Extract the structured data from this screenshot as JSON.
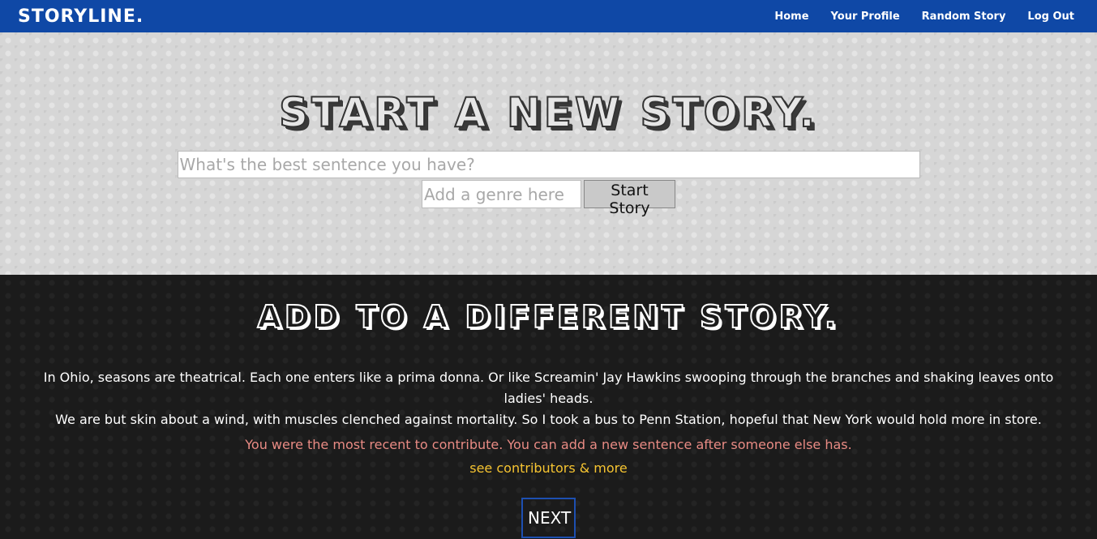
{
  "navbar": {
    "brand": "STORYLINE.",
    "links": [
      "Home",
      "Your Profile",
      "Random Story",
      "Log Out"
    ]
  },
  "new_story": {
    "title": "START A NEW STORY.",
    "sentence_placeholder": "What's the best sentence you have?",
    "genre_placeholder": "Add a genre here",
    "start_label": "Start Story"
  },
  "different_story": {
    "title": "ADD TO A DIFFERENT STORY.",
    "story_line1": "In Ohio, seasons are theatrical. Each one enters like a prima donna. Or like Screamin' Jay Hawkins swooping through the branches and shaking leaves onto ladies' heads.",
    "story_line2": "We are but skin about a wind, with muscles clenched against mortality. So I took a bus to Penn Station, hopeful that New York would hold more in store.",
    "notice": "You were the most recent to contribute. You can add a new sentence after someone else has.",
    "contributors_link": "see contributors & more",
    "next_label": "NEXT"
  },
  "colors": {
    "navbar": "#0f48a6",
    "notice": "#e98b84",
    "link": "#f6c431",
    "next_border": "#1d4fb1"
  }
}
